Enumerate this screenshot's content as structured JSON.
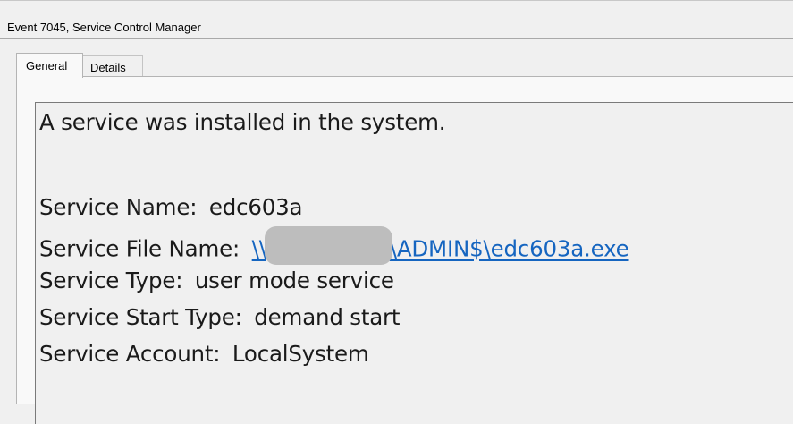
{
  "window": {
    "title": "Event 7045, Service Control Manager"
  },
  "tabs": [
    {
      "label": "General",
      "active": true
    },
    {
      "label": "Details",
      "active": false
    }
  ],
  "message": {
    "intro": "A service was installed in the system.",
    "fields": {
      "service_name_label": "Service Name:",
      "service_name_value": "edc603a",
      "service_file_label": "Service File Name:",
      "service_file_prefix": "\\\\",
      "service_file_suffix": "\\ADMIN$\\edc603a.exe",
      "service_type_label": "Service Type:",
      "service_type_value": "user mode service",
      "start_type_label": "Service Start Type:",
      "start_type_value": "demand start",
      "account_label": "Service Account:",
      "account_value": "LocalSystem"
    }
  },
  "colors": {
    "link": "#1565c0",
    "redaction": "#bdbdbd"
  }
}
